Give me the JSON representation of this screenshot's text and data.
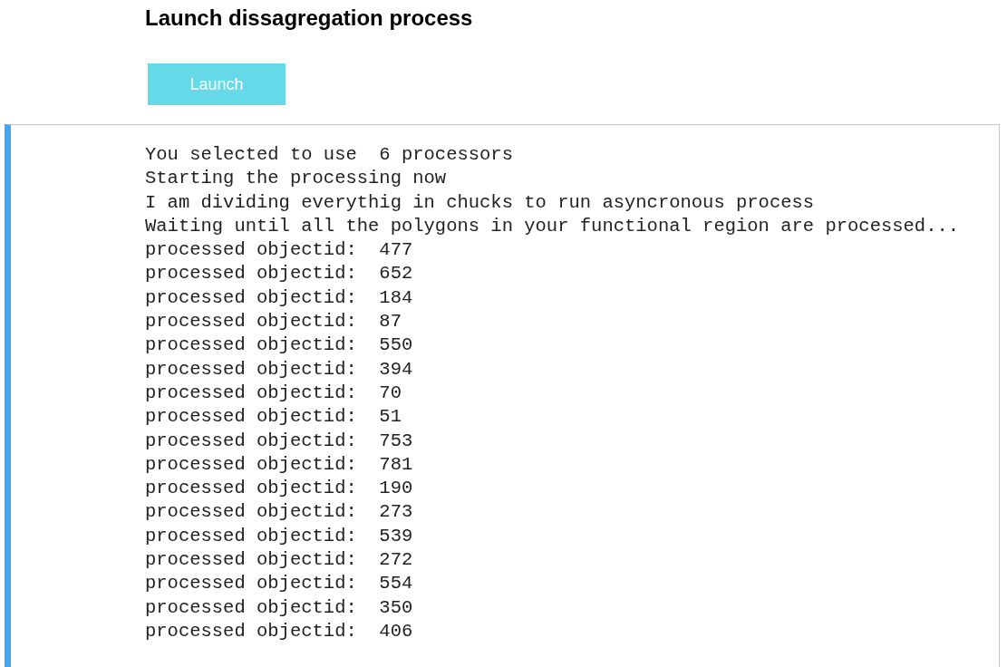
{
  "title": "Launch dissagregation process",
  "button": {
    "label": "Launch"
  },
  "output": {
    "lines": [
      "You selected to use  6 processors",
      "Starting the processing now",
      "I am dividing everythig in chucks to run asyncronous process",
      "Waiting until all the polygons in your functional region are processed...",
      "processed objectid:  477",
      "processed objectid:  652",
      "processed objectid:  184",
      "processed objectid:  87",
      "processed objectid:  550",
      "processed objectid:  394",
      "processed objectid:  70",
      "processed objectid:  51",
      "processed objectid:  753",
      "processed objectid:  781",
      "processed objectid:  190",
      "processed objectid:  273",
      "processed objectid:  539",
      "processed objectid:  272",
      "processed objectid:  554",
      "processed objectid:  350",
      "processed objectid:  406"
    ]
  }
}
